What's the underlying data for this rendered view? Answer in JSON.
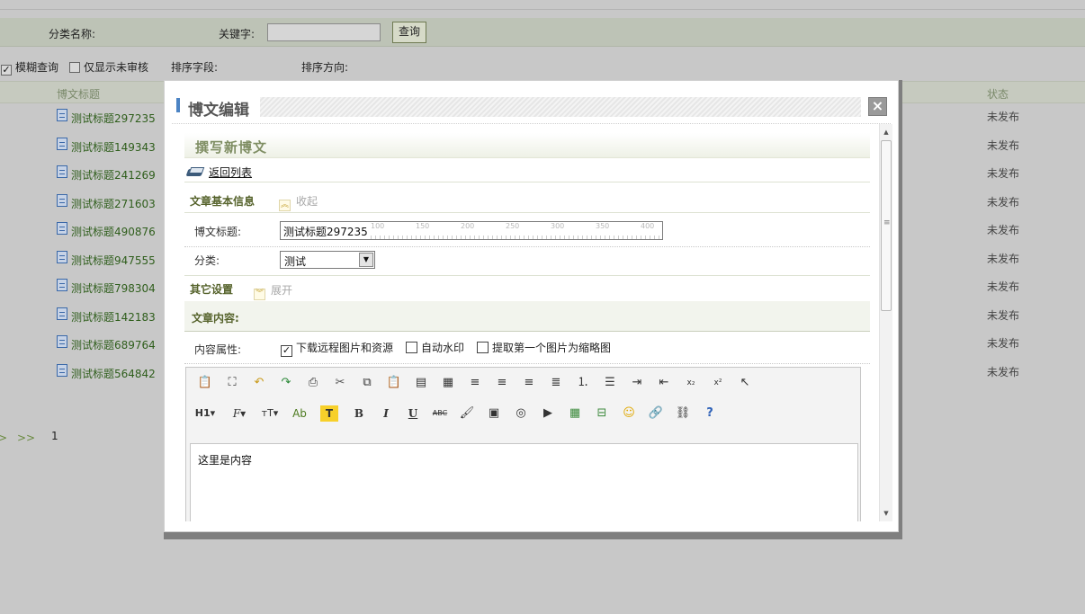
{
  "filter": {
    "category_label": "分类名称:",
    "keyword_label": "关键字:",
    "keyword_value": "",
    "query_button": "查询"
  },
  "options": {
    "fuzzy_label": "模糊查询",
    "fuzzy_checked": true,
    "unreviewed_label": "仅显示未审核",
    "unreviewed_checked": false,
    "sort_field_label": "排序字段:",
    "sort_direction_label": "排序方向:"
  },
  "list": {
    "col_title": "博文标题",
    "col_status": "状态",
    "rows": [
      {
        "title": "测试标题297235",
        "status": "未发布"
      },
      {
        "title": "测试标题149343",
        "status": "未发布"
      },
      {
        "title": "测试标题241269",
        "status": "未发布"
      },
      {
        "title": "测试标题271603",
        "status": "未发布"
      },
      {
        "title": "测试标题490876",
        "status": "未发布"
      },
      {
        "title": "测试标题947555",
        "status": "未发布"
      },
      {
        "title": "测试标题798304",
        "status": "未发布"
      },
      {
        "title": "测试标题142183",
        "status": "未发布"
      },
      {
        "title": "测试标题689764",
        "status": "未发布"
      },
      {
        "title": "测试标题564842",
        "status": "未发布"
      }
    ]
  },
  "pager": {
    "prev": ">",
    "next": ">>",
    "current": "1"
  },
  "modal": {
    "title": "博文编辑",
    "close_symbol": "×",
    "section_title": "撰写新博文",
    "back_link": "返回列表",
    "basic_info": {
      "heading": "文章基本信息",
      "toggle_label": "收起",
      "title_label": "博文标题:",
      "title_value": "测试标题297235",
      "ruler_ticks": [
        "100",
        "150",
        "200",
        "250",
        "300",
        "350",
        "400"
      ],
      "category_label": "分类:",
      "category_value": "测试"
    },
    "other_settings": {
      "heading": "其它设置",
      "toggle_label": "展开"
    },
    "content": {
      "heading": "文章内容:",
      "attr_label": "内容属性:",
      "options": [
        {
          "label": "下载远程图片和资源",
          "checked": true
        },
        {
          "label": "自动水印",
          "checked": false
        },
        {
          "label": "提取第一个图片为缩略图",
          "checked": false
        }
      ],
      "toolbar_row1": [
        "paste-icon",
        "fullscreen-icon",
        "undo-icon",
        "redo-icon",
        "print-icon",
        "cut-icon",
        "copy-icon",
        "paste-plain-icon",
        "paste-text-icon",
        "paste-word-icon",
        "align-left-icon",
        "align-center-icon",
        "align-right-icon",
        "justify-icon",
        "ordered-list-icon",
        "unordered-list-icon",
        "indent-icon",
        "outdent-icon",
        "subscript-icon",
        "superscript-icon",
        "select-all-icon"
      ],
      "toolbar_row2_labels": {
        "heading": "H1",
        "font_family": "F",
        "font_size": "тT",
        "font_color": "Ab",
        "highlight": "T",
        "bold": "B",
        "italic": "I",
        "underline": "U",
        "strikethrough": "ABC"
      },
      "toolbar_row2_icons": [
        "clear-format-icon",
        "image-icon",
        "flash-icon",
        "media-icon",
        "table-icon",
        "hr-icon",
        "emoticon-icon",
        "link-icon",
        "unlink-icon",
        "help-icon"
      ],
      "body_text": "这里是内容"
    }
  }
}
